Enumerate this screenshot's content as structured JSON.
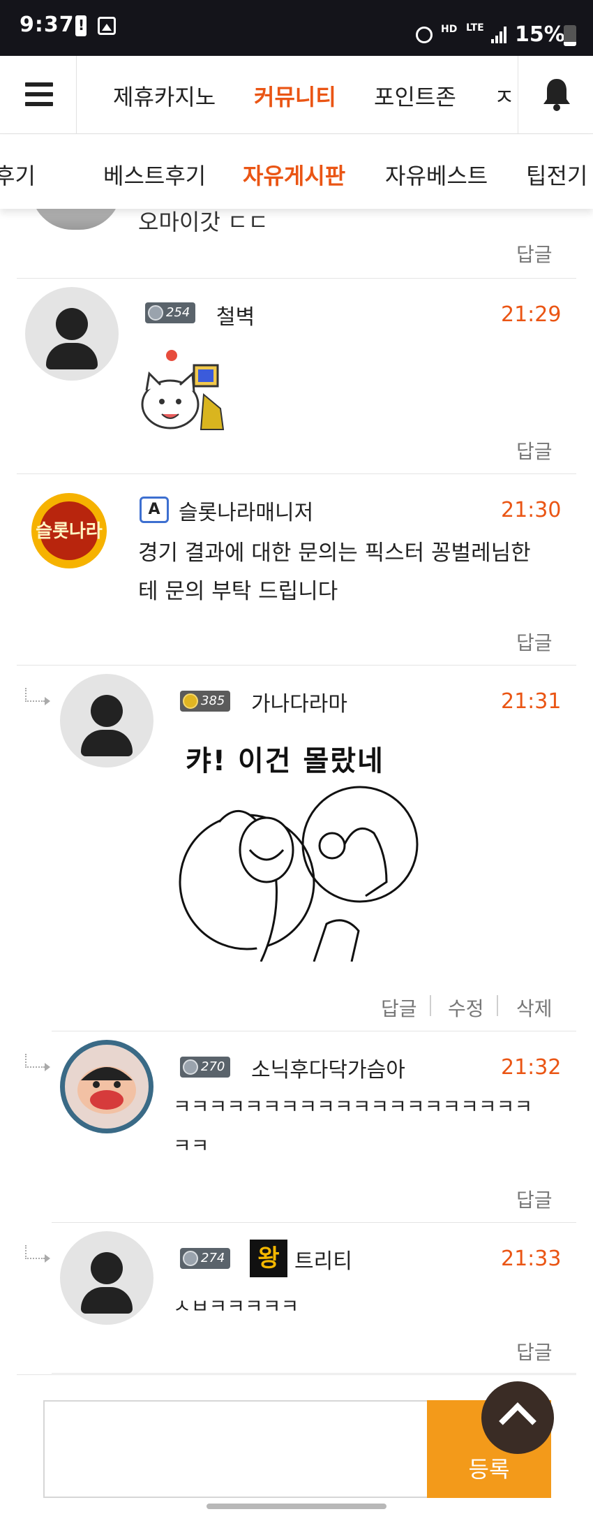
{
  "status_bar": {
    "time": "9:37",
    "battery_percent": "15%",
    "hd_label": "HD",
    "lte_label": "LTE"
  },
  "top_nav": {
    "tabs": [
      {
        "label": "제휴카지노",
        "active": false
      },
      {
        "label": "커뮤니티",
        "active": true
      },
      {
        "label": "포인트존",
        "active": false
      },
      {
        "label": "ㅈ",
        "active": false
      }
    ]
  },
  "sub_nav": {
    "tabs": [
      {
        "label": "후기",
        "active": false
      },
      {
        "label": "베스트후기",
        "active": false
      },
      {
        "label": "자유게시판",
        "active": true
      },
      {
        "label": "자유베스트",
        "active": false
      },
      {
        "label": "팁전기",
        "active": false
      }
    ]
  },
  "reply_label": "답글",
  "edit_label": "수정",
  "delete_label": "삭제",
  "partial_comment": {
    "text": "오마이갓 ㄷㄷ"
  },
  "comments": [
    {
      "level": "254",
      "username": "철벽",
      "time": "21:29",
      "sticker": "cat-computer-sticker"
    },
    {
      "admin_icon_label": "A",
      "username": "슬롯나라매니저",
      "time": "21:30",
      "text_line1": "경기 결과에 대한 문의는 픽스터 꽁벌레님한",
      "text_line2": "테 문의 부탁 드립니다",
      "avatar_logo_text": "슬롯나라"
    },
    {
      "level": "385",
      "username": "가나다라마",
      "time": "21:31",
      "sticker_caption": "캬! 이건 몰랐네"
    },
    {
      "level": "270",
      "username": "소닉후다닥가슴아",
      "time": "21:32",
      "text_line1": "ㅋㅋㅋㅋㅋㅋㅋㅋㅋㅋㅋㅋㅋㅋㅋㅋㅋㅋㅋㅋ",
      "text_line2": "ㅋㅋ"
    },
    {
      "level": "274",
      "king_badge": "왕",
      "username": "트리티",
      "time": "21:33",
      "text_line1": "ㅅㅂㅋㅋㅋㅋㅋ"
    }
  ],
  "composer": {
    "submit_label": "등록"
  },
  "colors": {
    "accent": "#ea5514",
    "submit": "#f39a1a",
    "status_bar": "#14141a"
  }
}
